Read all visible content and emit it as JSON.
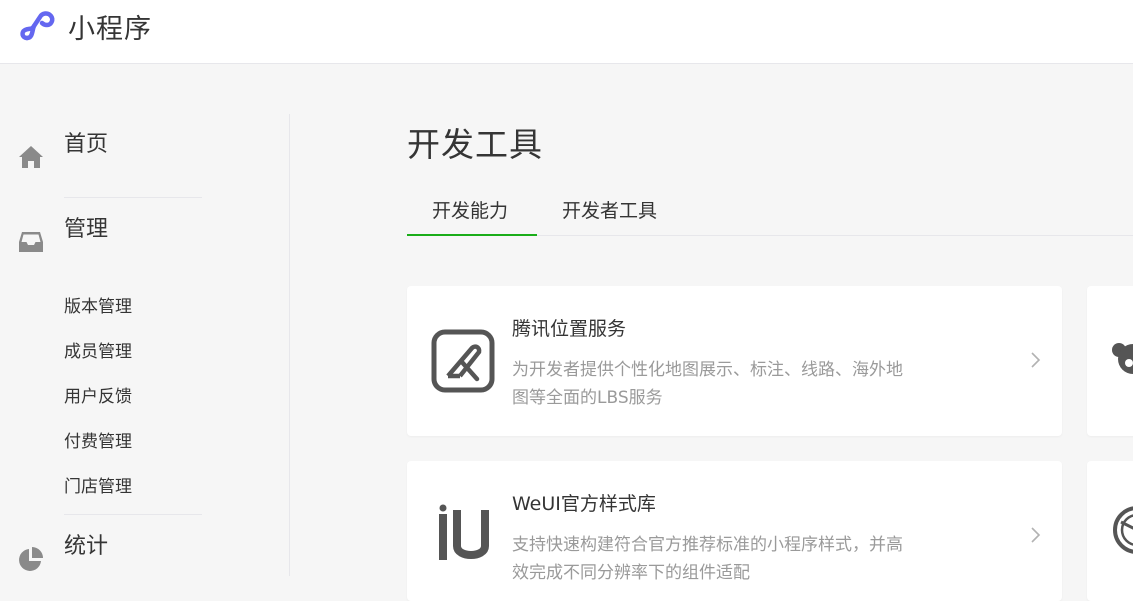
{
  "brand": {
    "name": "小程序",
    "logo_icon": "mini-program-logo-icon",
    "color": "#6467f0"
  },
  "sidebar": {
    "groups": [
      {
        "label": "首页",
        "icon": "home-icon"
      },
      {
        "label": "管理",
        "icon": "inbox-icon"
      },
      {
        "label": "统计",
        "icon": "pie-chart-icon"
      }
    ],
    "manage_items": [
      "版本管理",
      "成员管理",
      "用户反馈",
      "付费管理",
      "门店管理"
    ]
  },
  "main": {
    "title": "开发工具",
    "tabs": [
      {
        "label": "开发能力",
        "active": true
      },
      {
        "label": "开发者工具",
        "active": false
      }
    ],
    "cards": [
      {
        "title": "腾讯位置服务",
        "desc": "为开发者提供个性化地图展示、标注、线路、海外地图等全面的LBS服务",
        "icon": "tencent-location-icon"
      },
      {
        "title": "WeUI官方样式库",
        "desc": "支持快速构建符合官方推荐标准的小程序样式，并高效完成不同分辨率下的组件适配",
        "icon": "weui-logo-icon"
      }
    ]
  },
  "colors": {
    "accent_green": "#1aad19",
    "text": "#353535",
    "muted": "#9a9a9a",
    "icon_gray": "#8a8a8a"
  }
}
